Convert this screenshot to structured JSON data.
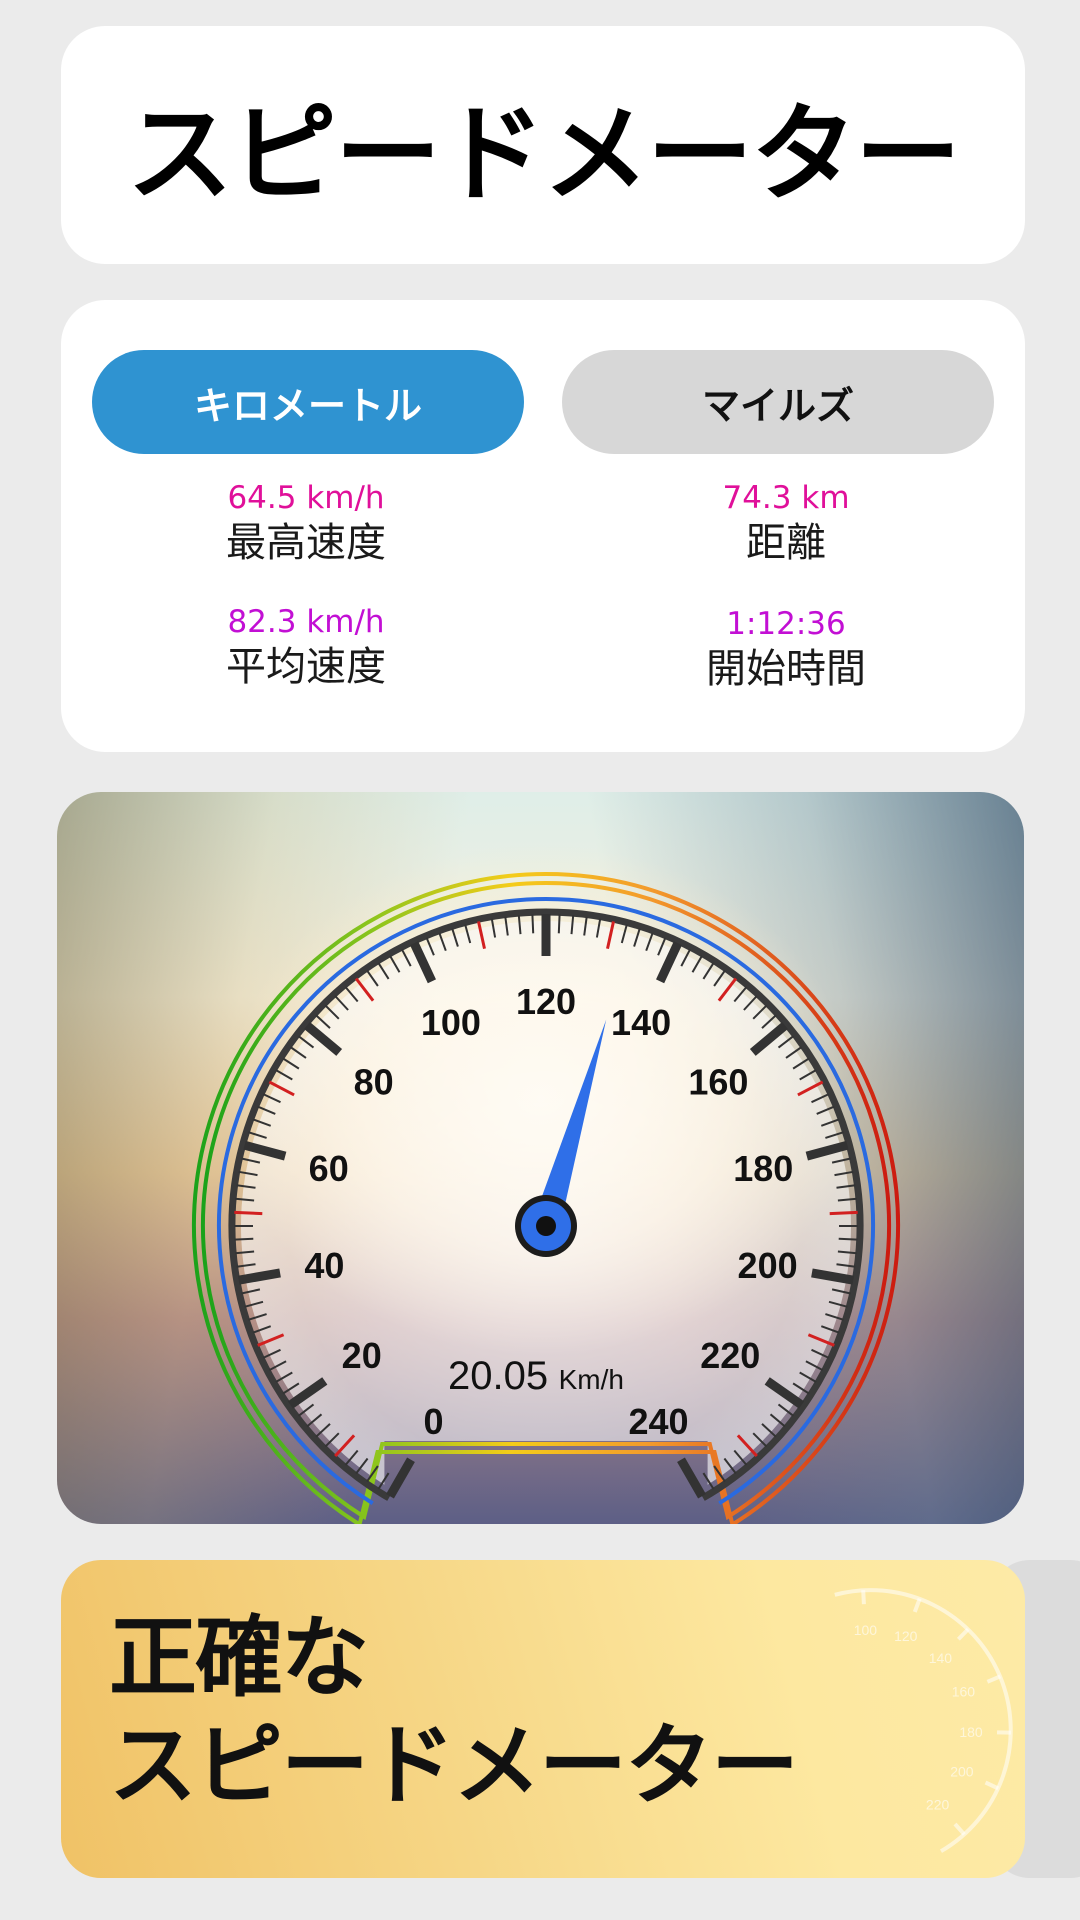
{
  "header": {
    "title": "スピードメーター"
  },
  "units": {
    "km_label": "キロメートル",
    "miles_label": "マイルズ",
    "selected": "km"
  },
  "stats": {
    "max_speed": {
      "value": "64.5 km/h",
      "label": "最高速度"
    },
    "distance": {
      "value": "74.3 km",
      "label": "距離"
    },
    "avg_speed": {
      "value": "82.3 km/h",
      "label": "平均速度"
    },
    "elapsed": {
      "value": "1:12:36",
      "label": "開始時間"
    }
  },
  "gauge": {
    "speed_value": "20.05",
    "speed_unit": "Km/h",
    "needle_value": 133,
    "min": 0,
    "max": 240,
    "major_labels": [
      "0",
      "20",
      "40",
      "60",
      "80",
      "100",
      "120",
      "140",
      "160",
      "180",
      "200",
      "220",
      "240"
    ],
    "colors": {
      "needle": "#2f6fe8",
      "tick": "#333333",
      "minor_red": "#d22020",
      "ring_blue": "#2a6ae0"
    }
  },
  "promo": {
    "line1": "正確な",
    "line2": "スピードメーター",
    "watermark_labels": [
      "100",
      "120",
      "140",
      "160",
      "180",
      "200",
      "220"
    ]
  }
}
